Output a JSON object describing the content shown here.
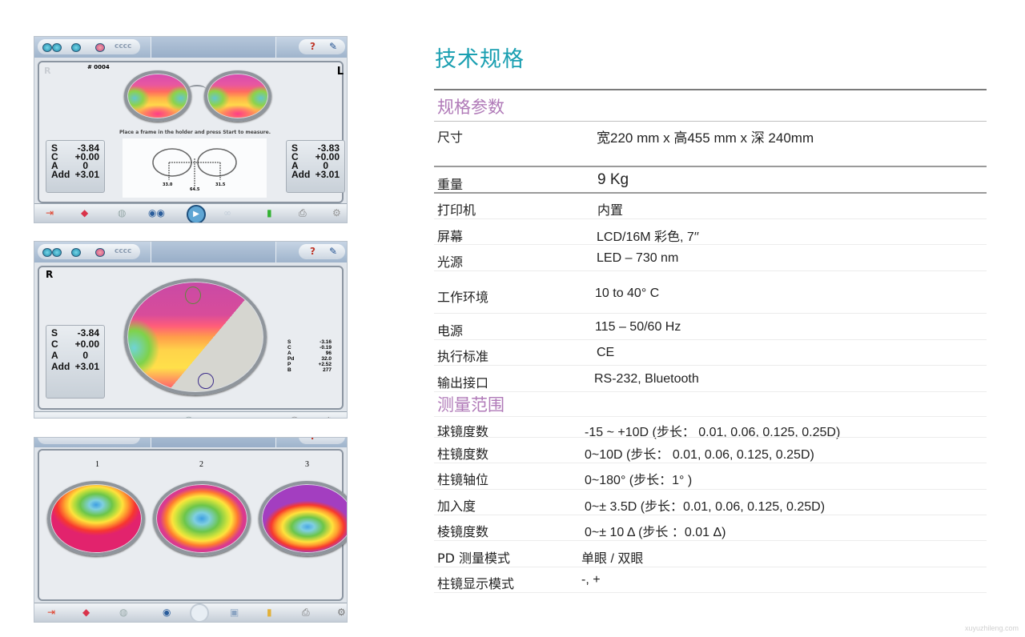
{
  "screens": [
    {
      "id": "binocular",
      "job_number": "# 0004",
      "side_left_label": "R",
      "side_right_label": "L",
      "instruction": "Place a frame in the holder and press Start to measure.",
      "pd": {
        "left": "33.0",
        "total": "64.5",
        "right": "31.5"
      },
      "readout_right_eye": {
        "S": "-3.84",
        "C": "+0.00",
        "A": "0",
        "Add": "+3.01"
      },
      "readout_left_eye": {
        "S": "-3.83",
        "C": "+0.00",
        "A": "0",
        "Add": "+3.01"
      }
    },
    {
      "id": "single-lens",
      "side_label": "R",
      "readout": {
        "S": "-3.84",
        "C": "+0.00",
        "A": "0",
        "Add": "+3.01"
      },
      "point_readout": {
        "S": "-3.16",
        "C": "-0.19",
        "A": "96",
        "Pd": "32.0",
        "P": "+2.52",
        "B": "277"
      }
    },
    {
      "id": "contact-lens-maps",
      "maps": [
        {
          "label": "1"
        },
        {
          "label": "2"
        },
        {
          "label": "3"
        }
      ]
    }
  ],
  "labels": {
    "S": "S",
    "C": "C",
    "A": "A",
    "Add": "Add",
    "Pd": "Pd",
    "P": "P",
    "B": "B"
  },
  "toolbar_icons": [
    "exit-icon",
    "eraser-icon",
    "lens-icon",
    "binocular-icon",
    "start-icon",
    "frame-icon",
    "battery-icon",
    "printer-icon",
    "settings-icon"
  ],
  "topbar": {
    "help": "?",
    "tools": "✎"
  },
  "spec": {
    "title": "技术规格",
    "section_params": "规格参数",
    "params": [
      {
        "label": "尺寸",
        "value": "宽220 mm x 高455 mm x 深 240mm"
      },
      {
        "label": "重量",
        "value": "9 Kg"
      },
      {
        "label": "打印机",
        "value": "内置"
      },
      {
        "label": "屏幕",
        "value": "LCD/16M 彩色, 7′′"
      },
      {
        "label": "光源",
        "value": "LED – 730 nm"
      },
      {
        "label": "工作环境",
        "value": "10 to 40° C"
      },
      {
        "label": "电源",
        "value": "115 – 50/60 Hz"
      },
      {
        "label": "执行标准",
        "value": "CE"
      },
      {
        "label": "输出接口",
        "value": "RS-232, Bluetooth"
      }
    ],
    "section_range": "测量范围",
    "ranges": [
      {
        "label": "球镜度数",
        "value": "-15 ~ +10D (步长： 0.01, 0.06, 0.125, 0.25D)"
      },
      {
        "label": "柱镜度数",
        "value": "0~10D (步长： 0.01, 0.06, 0.125, 0.25D)"
      },
      {
        "label": "柱镜轴位",
        "value": "0~180° (步长：1° )"
      },
      {
        "label": "加入度",
        "value": "0~± 3.5D (步长：0.01, 0.06, 0.125, 0.25D)"
      },
      {
        "label": "棱镜度数",
        "value": "0~± 10 Δ (步长 ：0.01 Δ)"
      },
      {
        "label": "PD 测量模式",
        "value": "单眼 / 双眼"
      },
      {
        "label": "柱镜显示模式",
        "value": "-, +"
      }
    ]
  },
  "watermark": "xuyuzhileng.com",
  "colors": {
    "title": "#1a9fb1",
    "section": "#b07ab8"
  }
}
